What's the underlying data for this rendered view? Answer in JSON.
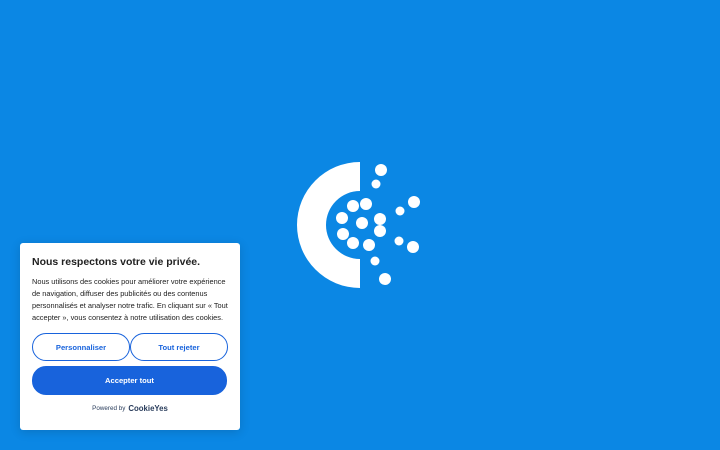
{
  "colors": {
    "background": "#0b87e4",
    "accent": "#1863dc",
    "banner_bg": "#ffffff",
    "text": "#212121"
  },
  "loader": {
    "icon": "cookieyes-loader-icon"
  },
  "cookie_banner": {
    "title": "Nous respectons votre vie privée.",
    "description": "Nous utilisons des cookies pour améliorer votre expérience de navigation, diffuser des publicités ou des contenus personnalisés et analyser notre trafic. En cliquant sur « Tout accepter », vous consentez à notre utilisation des cookies.",
    "customize_label": "Personnaliser",
    "reject_label": "Tout rejeter",
    "accept_label": "Accepter tout",
    "powered_by": "Powered by",
    "brand": "CookieYes"
  }
}
